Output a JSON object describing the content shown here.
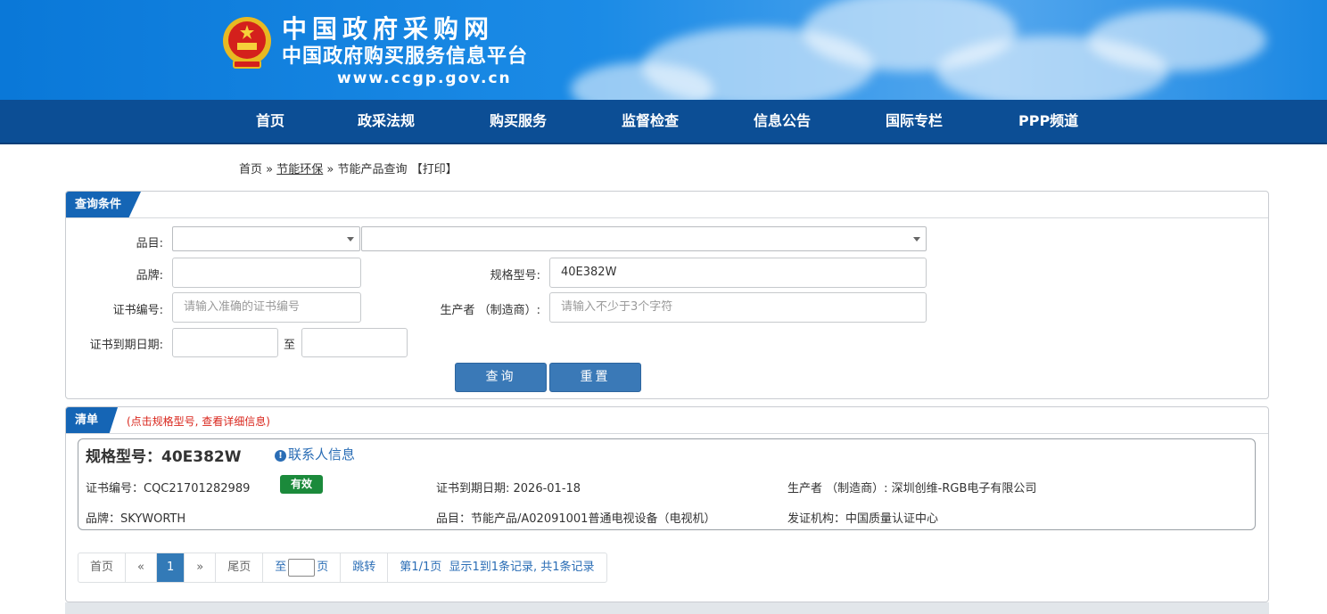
{
  "header": {
    "title": "中国政府采购网",
    "subtitle": "中国政府购买服务信息平台",
    "url": "www.ccgp.gov.cn",
    "emblem_icon": "national-emblem-icon"
  },
  "nav": {
    "items": [
      {
        "label": "首页"
      },
      {
        "label": "政采法规"
      },
      {
        "label": "购买服务"
      },
      {
        "label": "监督检查"
      },
      {
        "label": "信息公告"
      },
      {
        "label": "国际专栏"
      },
      {
        "label": "PPP频道"
      }
    ]
  },
  "breadcrumb": {
    "home": "首页",
    "sep": "»",
    "section": "节能环保",
    "current": "节能产品查询",
    "print": "【打印】"
  },
  "query": {
    "panel_title": "查询条件",
    "category_label": "品目:",
    "brand_label": "品牌:",
    "brand_value": "",
    "model_label": "规格型号:",
    "model_value": "40E382W",
    "cert_no_label": "证书编号:",
    "cert_no_placeholder": "请输入准确的证书编号",
    "maker_label": "生产者 （制造商）:",
    "maker_placeholder": "请输入不少于3个字符",
    "expiry_label": "证书到期日期:",
    "expiry_to": "至",
    "search_button": "查询",
    "reset_button": "重置"
  },
  "results": {
    "panel_title": "清单",
    "hint": "(点击规格型号, 查看详细信息)",
    "items": [
      {
        "title": "规格型号：40E382W",
        "contact": "联系人信息",
        "cert_no": "证书编号：CQC21701282989",
        "status": "有效",
        "expiry": "证书到期日期: 2026-01-18",
        "maker": "生产者 （制造商）: 深圳创维-RGB电子有限公司",
        "brand": "品牌：SKYWORTH",
        "category": "品目：节能产品/A02091001普通电视设备（电视机）",
        "issuer": "发证机构：中国质量认证中心"
      }
    ]
  },
  "pager": {
    "first": "首页",
    "prev": "«",
    "current": "1",
    "next": "»",
    "last": "尾页",
    "goto_prefix": "至",
    "goto_suffix": "页",
    "jump": "跳转",
    "info": "第1/1页  显示1到1条记录, 共1条记录"
  },
  "colors": {
    "header_blue": "#0a78d8",
    "nav_blue": "#0c4e95",
    "panel_tag": "#1565b5",
    "button": "#3a79b7",
    "badge_green": "#1b8a3b",
    "hint_red": "#d9261c",
    "link_blue": "#2a6db5"
  }
}
